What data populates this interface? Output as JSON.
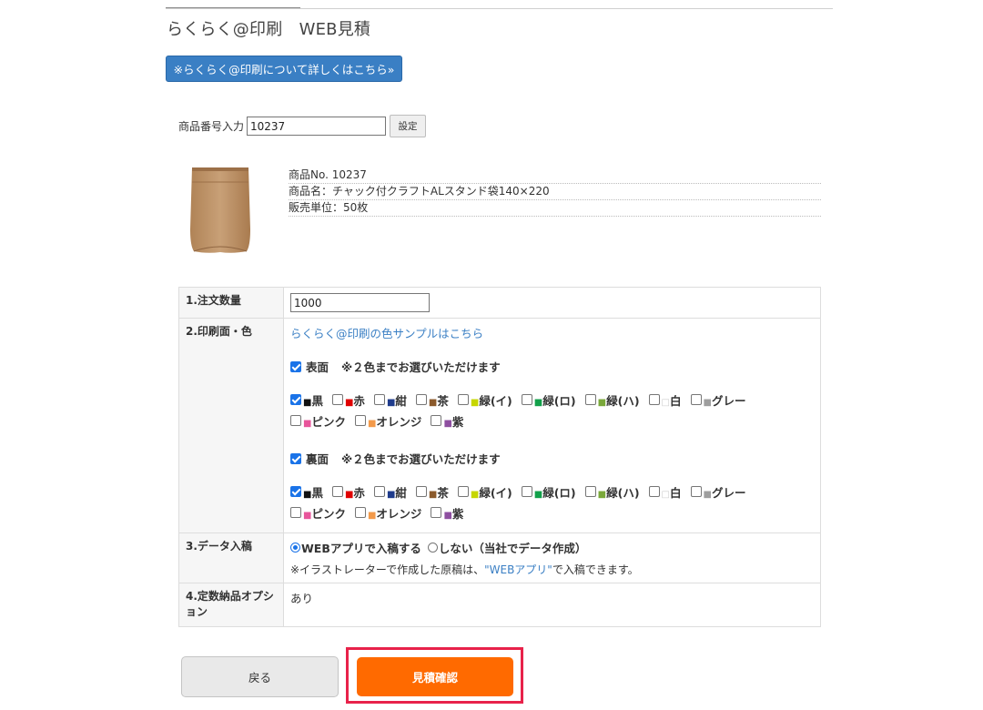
{
  "header": {
    "title": "らくらく@印刷　WEB見積",
    "info_button_label": "※らくらく@印刷について詳しくはこちら»"
  },
  "product_search": {
    "label": "商品番号入力",
    "value": "10237",
    "set_button_label": "設定"
  },
  "product": {
    "number_line": "商品No.  10237",
    "name_line": "商品名：チャック付クラフトALスタンド袋140×220",
    "unit_line": "販売単位：50枚"
  },
  "form": {
    "quantity": {
      "label": "1.注文数量",
      "value": "1000"
    },
    "print": {
      "label": "2.印刷面・色",
      "sample_link": "らくらく@印刷の色サンプルはこちら",
      "front": {
        "label": "表面",
        "checked": true,
        "note": "※２色までお選びいただけます",
        "colors": [
          {
            "name": "■黒",
            "swatch": "#111111",
            "checked": true
          },
          {
            "name": "■赤",
            "swatch": "#e00000",
            "checked": false
          },
          {
            "name": "■紺",
            "swatch": "#1f3c8c",
            "checked": false
          },
          {
            "name": "■茶",
            "swatch": "#8b5a2b",
            "checked": false
          },
          {
            "name": "■緑(イ)",
            "swatch": "#c6d600",
            "checked": false
          },
          {
            "name": "■緑(ロ)",
            "swatch": "#12a04a",
            "checked": false
          },
          {
            "name": "■緑(ハ)",
            "swatch": "#7aa83a",
            "checked": false
          },
          {
            "name": "□白",
            "swatch": "#ffffff",
            "checked": false
          },
          {
            "name": "■グレー",
            "swatch": "#9e9e9e",
            "checked": false
          },
          {
            "name": "■ピンク",
            "swatch": "#e8559b",
            "checked": false
          },
          {
            "name": "■オレンジ",
            "swatch": "#f39a4a",
            "checked": false
          },
          {
            "name": "■紫",
            "swatch": "#8e4fa0",
            "checked": false
          }
        ]
      },
      "back": {
        "label": "裏面",
        "checked": true,
        "note": "※２色までお選びいただけます",
        "colors": [
          {
            "name": "■黒",
            "swatch": "#111111",
            "checked": true
          },
          {
            "name": "■赤",
            "swatch": "#e00000",
            "checked": false
          },
          {
            "name": "■紺",
            "swatch": "#1f3c8c",
            "checked": false
          },
          {
            "name": "■茶",
            "swatch": "#8b5a2b",
            "checked": false
          },
          {
            "name": "■緑(イ)",
            "swatch": "#c6d600",
            "checked": false
          },
          {
            "name": "■緑(ロ)",
            "swatch": "#12a04a",
            "checked": false
          },
          {
            "name": "■緑(ハ)",
            "swatch": "#7aa83a",
            "checked": false
          },
          {
            "name": "□白",
            "swatch": "#ffffff",
            "checked": false
          },
          {
            "name": "■グレー",
            "swatch": "#9e9e9e",
            "checked": false
          },
          {
            "name": "■ピンク",
            "swatch": "#e8559b",
            "checked": false
          },
          {
            "name": "■オレンジ",
            "swatch": "#f39a4a",
            "checked": false
          },
          {
            "name": "■紫",
            "swatch": "#8e4fa0",
            "checked": false
          }
        ]
      }
    },
    "data_submission": {
      "label": "3.データ入稿",
      "option_web": "WEBアプリで入稿する",
      "option_none": "しない（当社でデータ作成）",
      "selected": "web",
      "note_before": "※イラストレーターで作成した原稿は、",
      "note_link": "\"WEBアプリ\"",
      "note_after": "で入稿できます。"
    },
    "fixed_option": {
      "label": "4.定数納品オプション",
      "value": "あり"
    }
  },
  "actions": {
    "back_label": "戻る",
    "estimate_label": "見積確認"
  },
  "colors": {
    "accent": "#3a7fc4",
    "primary_button": "#ff6a00",
    "highlight": "#e8224a"
  }
}
